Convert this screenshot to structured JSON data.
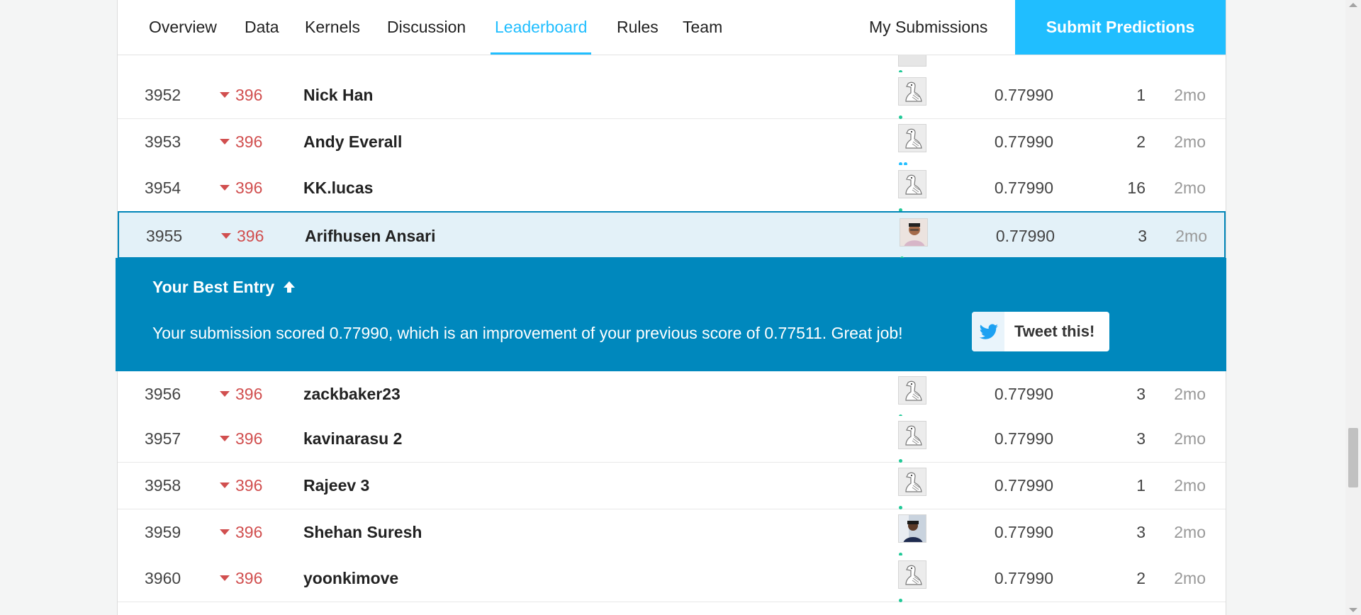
{
  "nav": {
    "tabs": [
      "Overview",
      "Data",
      "Kernels",
      "Discussion",
      "Leaderboard",
      "Rules",
      "Team"
    ],
    "active_tab": "Leaderboard",
    "my_submissions": "My Submissions",
    "submit_predictions": "Submit Predictions",
    "accent_color": "#20beff"
  },
  "rows_above": [
    {
      "rank": "3952",
      "delta": "396",
      "team": "Nick Han",
      "score": "0.77990",
      "entries": "1",
      "last": "2mo",
      "avatar": "goose-avatar-icon"
    },
    {
      "rank": "3953",
      "delta": "396",
      "team": "Andy Everall",
      "score": "0.77990",
      "entries": "2",
      "last": "2mo",
      "avatar": "goose-avatar-icon"
    },
    {
      "rank": "3954",
      "delta": "396",
      "team": "KK.lucas",
      "score": "0.77990",
      "entries": "16",
      "last": "2mo",
      "avatar": "goose-avatar-icon"
    }
  ],
  "selected_row": {
    "rank": "3955",
    "delta": "396",
    "team": "Arifhusen Ansari",
    "score": "0.77990",
    "entries": "3",
    "last": "2mo",
    "avatar": "person-avatar-icon"
  },
  "best_entry": {
    "title": "Your Best Entry",
    "message": "Your submission scored 0.77990, which is an improvement of your previous score of 0.77511. Great job!",
    "tweet_label": "Tweet this!",
    "banner_color": "#0088bd"
  },
  "rows_below": [
    {
      "rank": "3956",
      "delta": "396",
      "team": "zackbaker23",
      "score": "0.77990",
      "entries": "3",
      "last": "2mo",
      "avatar": "goose-avatar-icon"
    },
    {
      "rank": "3957",
      "delta": "396",
      "team": "kavinarasu 2",
      "score": "0.77990",
      "entries": "3",
      "last": "2mo",
      "avatar": "goose-avatar-icon"
    },
    {
      "rank": "3958",
      "delta": "396",
      "team": "Rajeev 3",
      "score": "0.77990",
      "entries": "1",
      "last": "2mo",
      "avatar": "goose-avatar-icon"
    },
    {
      "rank": "3959",
      "delta": "396",
      "team": "Shehan Suresh",
      "score": "0.77990",
      "entries": "3",
      "last": "2mo",
      "avatar": "person-avatar-icon"
    },
    {
      "rank": "3960",
      "delta": "396",
      "team": "yoonkimove",
      "score": "0.77990",
      "entries": "2",
      "last": "2mo",
      "avatar": "goose-avatar-icon"
    }
  ],
  "rank_change_color": "#d14f4f"
}
